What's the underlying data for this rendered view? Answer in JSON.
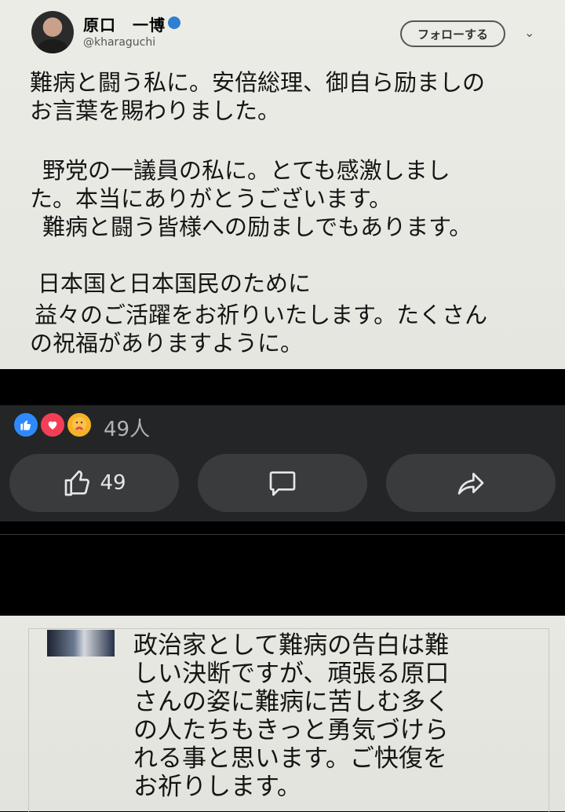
{
  "tweet": {
    "author_name": "原口　一博",
    "handle": "@kharaguchi",
    "follow_label": "フォローする",
    "lines": [
      "難病と闘う私に。安倍総理、御自ら励ましの",
      "お言葉を賜わりました。",
      "野党の一議員の私に。とても感激しまし",
      "た。本当にありがとうございます。",
      "難病と闘う皆様への励ましでもあります。",
      "日本国と日本国民のために",
      "益々のご活躍をお祈りいたします。たくさん",
      "の祝福がありますように。"
    ]
  },
  "facebook": {
    "reactions": [
      "like",
      "love",
      "care"
    ],
    "reaction_count": "49人",
    "like_count": "49",
    "colors": {
      "panel": "#242526",
      "button": "#3a3b3c",
      "like": "#2e89ff",
      "love": "#f33e58",
      "care": "#f7b125"
    }
  },
  "comment": {
    "lines": [
      "政治家として難病の告白は難",
      "しい決断ですが、頑張る原口",
      "さんの姿に難病に苦しむ多く",
      "の人たちもきっと勇気づけら",
      "れる事と思います。ご快復を",
      "お祈りします。"
    ]
  }
}
